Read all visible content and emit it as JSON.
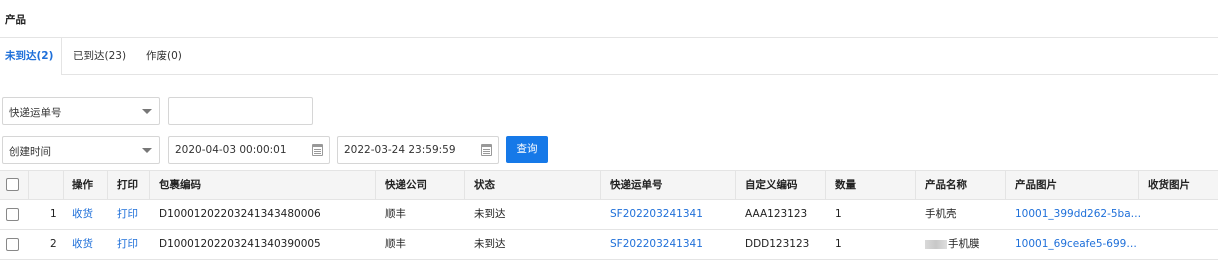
{
  "header": {
    "title": "产品"
  },
  "tabs": [
    {
      "label": "未到达(2)"
    },
    {
      "label": "已到达(23)"
    },
    {
      "label": "作废(0)"
    }
  ],
  "filters": {
    "field_select": "快递运单号",
    "field_value": "",
    "time_select": "创建时间",
    "start_date": "2020-04-03 00:00:01",
    "end_date": "2022-03-24 23:59:59",
    "query_button": "查询"
  },
  "table": {
    "columns": [
      "操作",
      "打印",
      "包裹编码",
      "快递公司",
      "状态",
      "快递运单号",
      "自定义编码",
      "数量",
      "产品名称",
      "产品图片",
      "收货图片"
    ],
    "rows": [
      {
        "index": "1",
        "action": "收货",
        "print": "打印",
        "package_code": "D1000120220324134348000​6",
        "courier": "顺丰",
        "status": "未到达",
        "tracking": "SF202203241341",
        "custom_code": "AAA123123",
        "qty": "1",
        "product_name": "手机壳",
        "product_image": "10001_399dd262-5ba…",
        "receipt_image": ""
      },
      {
        "index": "2",
        "action": "收货",
        "print": "打印",
        "package_code": "D10001202203241340390005",
        "courier": "顺丰",
        "status": "未到达",
        "tracking": "SF202203241341",
        "custom_code": "DDD123123",
        "qty": "1",
        "product_name": "手机膜",
        "product_image": "10001_69ceafe5-699…",
        "receipt_image": ""
      }
    ]
  },
  "colors": {
    "accent": "#1e6fd9",
    "button": "#1679e8",
    "border": "#e4e4e4",
    "header_bg": "#f5f5f5"
  }
}
